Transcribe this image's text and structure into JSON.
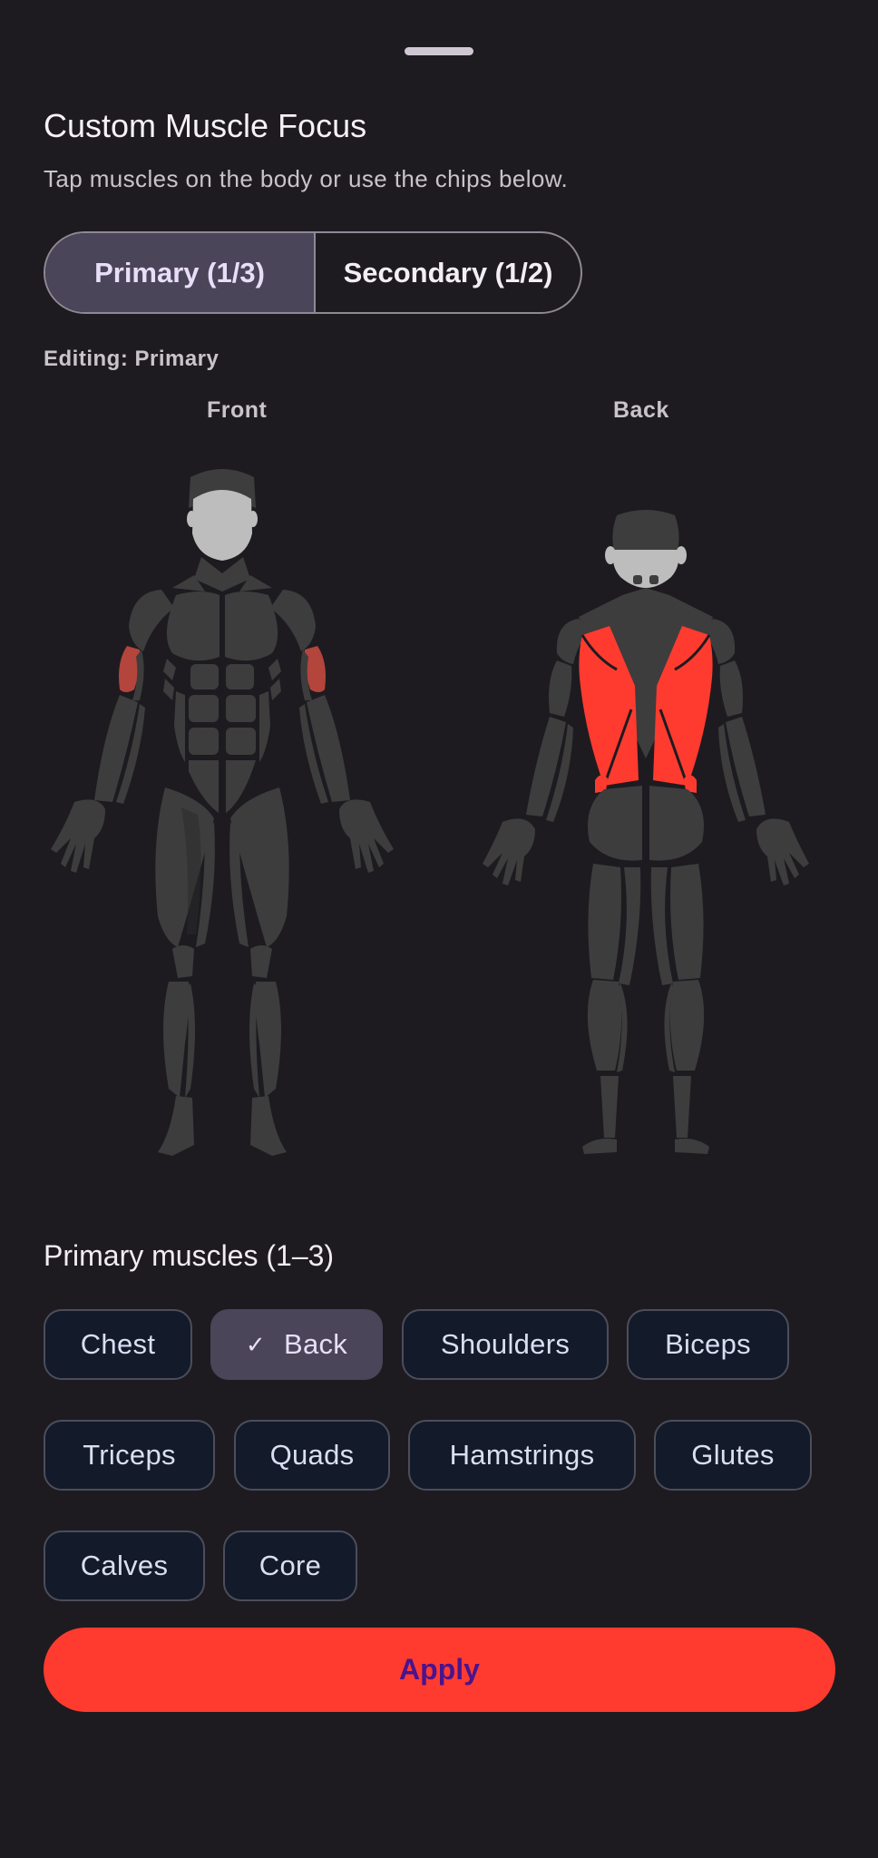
{
  "sheet": {
    "title": "Custom Muscle Focus",
    "subtitle": "Tap muscles on the body or use the chips below."
  },
  "segments": {
    "primary_label": "Primary (1/3)",
    "secondary_label": "Secondary (1/2)",
    "selected": "primary"
  },
  "editing_label": "Editing: Primary",
  "body_views": {
    "front_label": "Front",
    "back_label": "Back",
    "highlighted_primary": [
      "Back"
    ],
    "highlighted_secondary": [
      "Biceps"
    ]
  },
  "primary_section": {
    "title": "Primary muscles (1–3)",
    "chips": [
      {
        "label": "Chest",
        "selected": false
      },
      {
        "label": "Back",
        "selected": true
      },
      {
        "label": "Shoulders",
        "selected": false
      },
      {
        "label": "Biceps",
        "selected": false
      },
      {
        "label": "Triceps",
        "selected": false
      },
      {
        "label": "Quads",
        "selected": false
      },
      {
        "label": "Hamstrings",
        "selected": false
      },
      {
        "label": "Glutes",
        "selected": false
      },
      {
        "label": "Calves",
        "selected": false
      },
      {
        "label": "Core",
        "selected": false
      }
    ],
    "check_icon": "check-icon"
  },
  "apply_label": "Apply",
  "colors": {
    "background": "#1d1b20",
    "muscle": "#3d3d3d",
    "skin": "#bdbdbd",
    "primary_highlight": "#ff3b2f",
    "secondary_highlight": "#b3453c",
    "chip_bg": "#131a2a",
    "chip_selected_bg": "#4a4558",
    "apply_bg": "#ff3b2f",
    "apply_text": "#4a148c"
  }
}
